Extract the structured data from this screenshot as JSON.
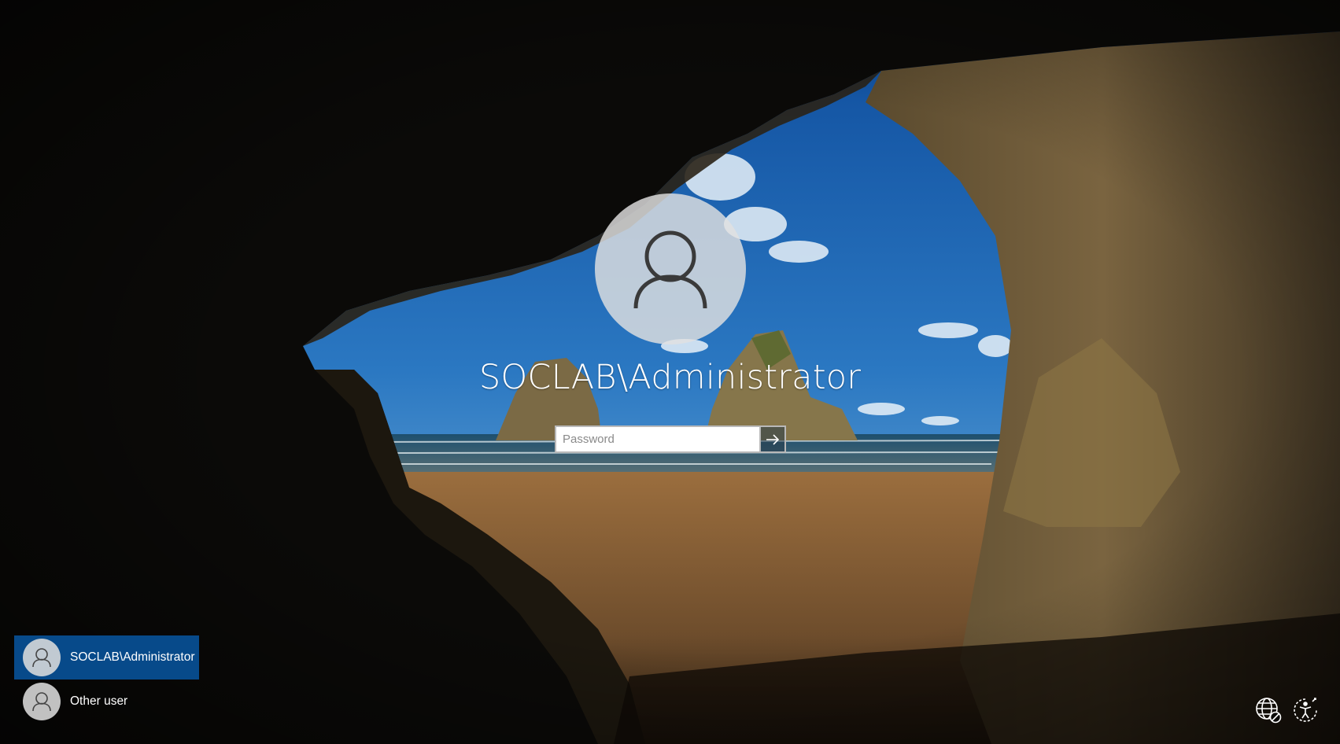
{
  "login": {
    "username": "SOCLAB\\Administrator",
    "password_placeholder": "Password",
    "password_value": ""
  },
  "user_list": [
    {
      "label": "SOCLAB\\Administrator",
      "selected": true
    },
    {
      "label": "Other user",
      "selected": false
    }
  ],
  "icons": {
    "avatar": "user-icon",
    "submit": "arrow-right-icon",
    "network": "network-globe-icon",
    "ease_of_access": "ease-of-access-icon"
  },
  "colors": {
    "selected_user_bg": "#074a8a",
    "avatar_bg": "#e1e1e1",
    "text": "#ffffff"
  }
}
